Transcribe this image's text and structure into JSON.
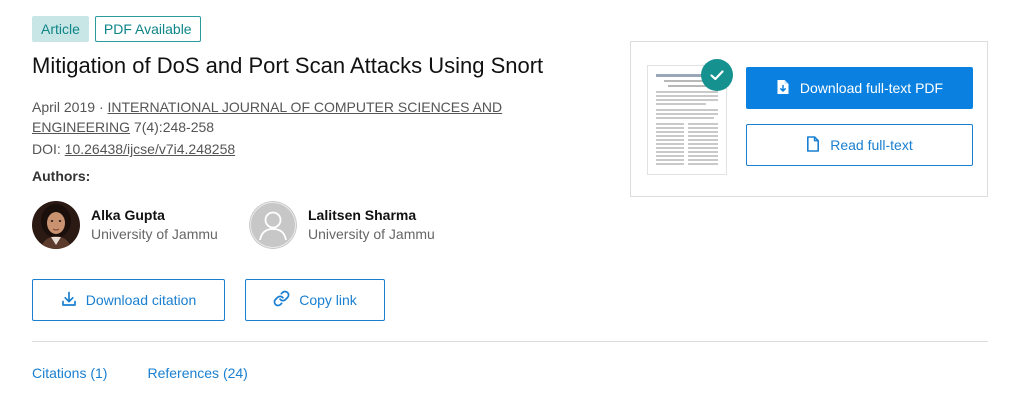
{
  "badges": {
    "type": "Article",
    "availability": "PDF Available"
  },
  "title": "Mitigation of DoS and Port Scan Attacks Using Snort",
  "meta": {
    "date": "April 2019",
    "separator": "·",
    "journal": "INTERNATIONAL JOURNAL OF COMPUTER SCIENCES AND ENGINEERING",
    "volume_pages": "7(4):248-258",
    "doi_label": "DOI:",
    "doi": "10.26438/ijcse/v7i4.248258"
  },
  "authors_label": "Authors:",
  "authors": [
    {
      "name": "Alka Gupta",
      "affiliation": "University of Jammu"
    },
    {
      "name": "Lalitsen Sharma",
      "affiliation": "University of Jammu"
    }
  ],
  "actions": {
    "download_citation": "Download citation",
    "copy_link": "Copy link"
  },
  "tabs": [
    {
      "label": "Citations (1)"
    },
    {
      "label": "References (24)"
    }
  ],
  "fulltext": {
    "download_pdf": "Download full-text PDF",
    "read": "Read full-text"
  },
  "icons": {
    "download": "download-icon",
    "link": "link-icon",
    "pdf_download": "pdf-download-icon",
    "document": "document-icon",
    "check": "check-icon",
    "avatar_placeholder": "person-placeholder-icon"
  },
  "colors": {
    "accent": "#0a81e0",
    "teal": "#15918f",
    "badge_bg": "#c8e6e6"
  }
}
